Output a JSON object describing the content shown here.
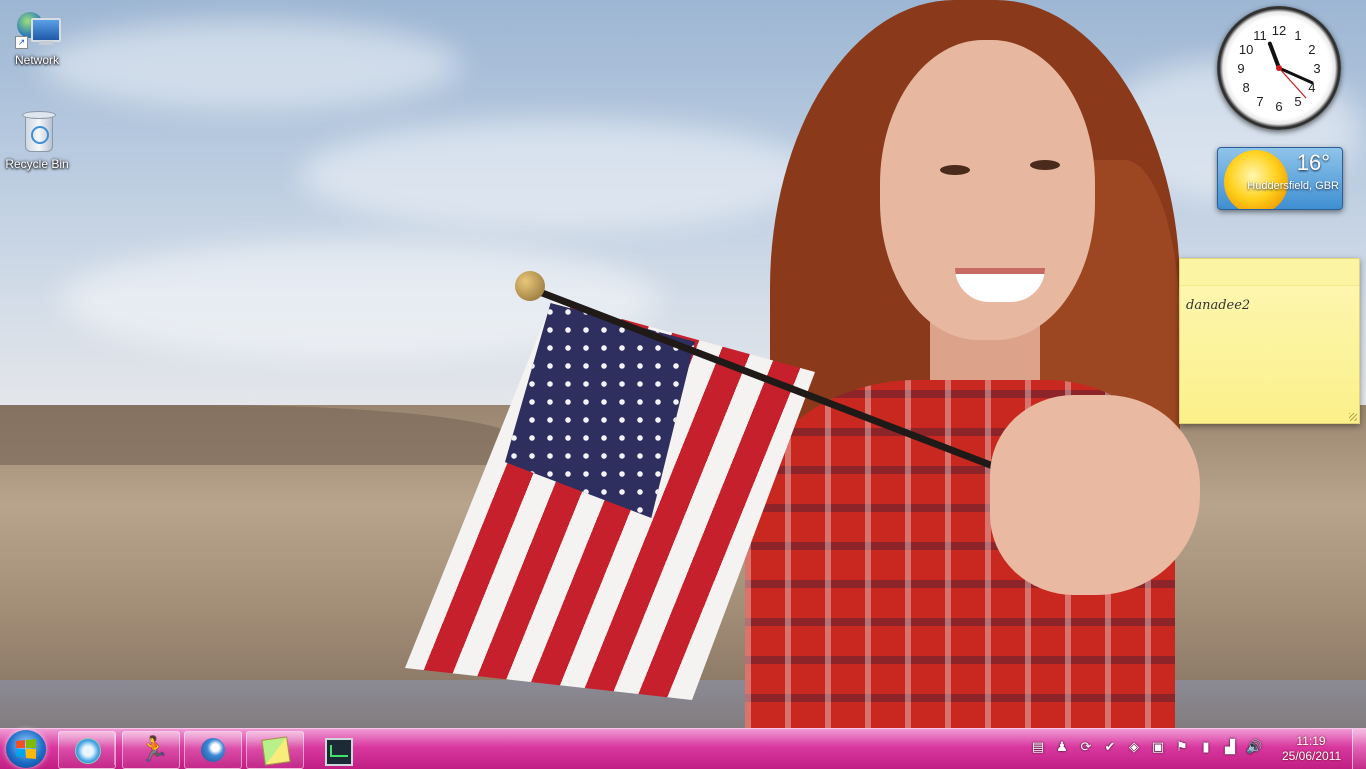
{
  "desktop": {
    "icons": [
      {
        "label": "Network",
        "icon": "network-icon"
      },
      {
        "label": "Recycle Bin",
        "icon": "recycle-bin-icon"
      }
    ]
  },
  "gadgets": {
    "clock": {
      "hour": 11,
      "minute": 19,
      "second": 23
    },
    "weather": {
      "temperature": "16°",
      "location": "Huddersfield, GBR",
      "condition_icon": "sun-icon"
    },
    "note": {
      "text": "danadee2"
    }
  },
  "taskbar": {
    "start_icon": "windows-logo-icon",
    "pinned": [
      {
        "name": "safari",
        "icon": "safari-compass-icon"
      },
      {
        "name": "aim",
        "icon": "aim-running-man-icon",
        "glyph": "🏃"
      },
      {
        "name": "thunderbird",
        "icon": "thunderbird-icon"
      },
      {
        "name": "sticky-notes",
        "icon": "sticky-notes-icon"
      },
      {
        "name": "task-manager",
        "icon": "task-manager-icon"
      }
    ],
    "tray": [
      {
        "icon": "usb-device-icon",
        "glyph": "▤"
      },
      {
        "icon": "messenger-icon",
        "glyph": "♟"
      },
      {
        "icon": "sync-icon",
        "glyph": "⟳"
      },
      {
        "icon": "checkmark-icon",
        "glyph": "✔"
      },
      {
        "icon": "app-icon",
        "glyph": "◈"
      },
      {
        "icon": "monitor-icon",
        "glyph": "▣"
      },
      {
        "icon": "flag-clock-icon",
        "glyph": "⚑"
      },
      {
        "icon": "battery-icon",
        "glyph": "▮"
      },
      {
        "icon": "network-signal-icon",
        "glyph": "▟"
      },
      {
        "icon": "volume-icon",
        "glyph": "🔊"
      }
    ],
    "time": "11:19",
    "date": "25/06/2011"
  }
}
